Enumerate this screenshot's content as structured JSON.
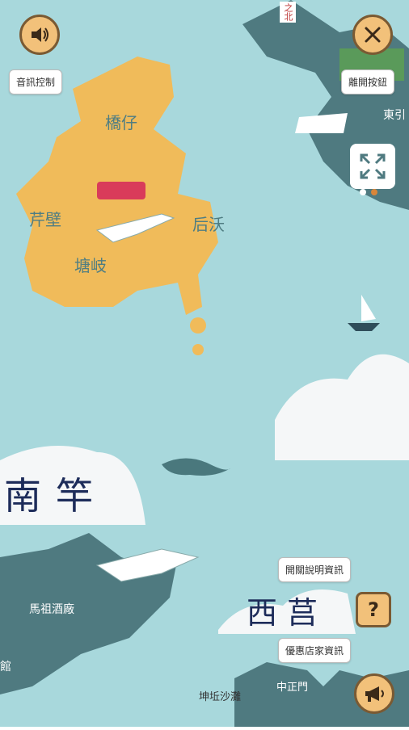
{
  "controls": {
    "audio_label": "音訊控制",
    "exit_label": "離開按鈕",
    "about_label": "開關說明資訊",
    "shops_label": "優惠店家資訊"
  },
  "map_labels": {
    "qiaozi": "橋仔",
    "furbi": "芹壁",
    "houwo": "后沃",
    "tangqi": "塘岐",
    "nangan": "南竿",
    "xiju": "西莒",
    "winery": "馬祖酒廠",
    "hall_partial": "館",
    "kunqiu_beach": "坤坵沙灘",
    "zhongzheng_gate": "中正門",
    "dongyin_partial": "東引",
    "north_partial": "之北"
  },
  "colors": {
    "sea": "#a8d8dc",
    "land_main": "#f0bb5a",
    "land_dark": "#4f7a80",
    "accent_button": "#f2c17a"
  },
  "page_indicator": {
    "active_index": 1,
    "total": 2
  }
}
